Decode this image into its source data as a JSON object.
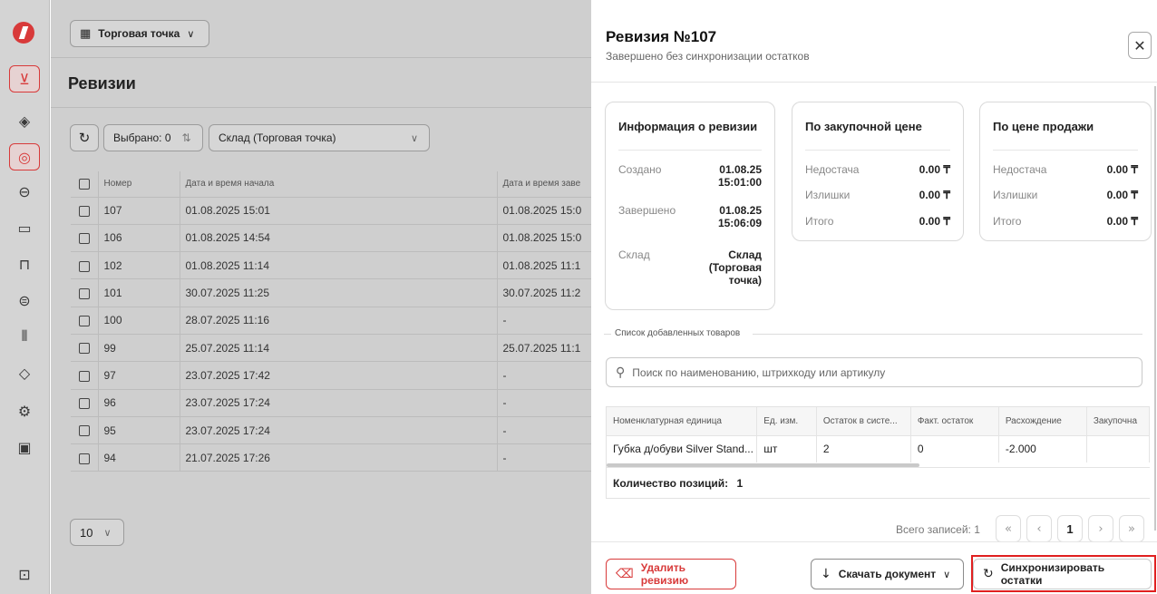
{
  "sidebar": {
    "icons": [
      "logo-icon",
      "cart-icon",
      "box-icon",
      "stack-icon",
      "bag-icon",
      "wallet-icon",
      "receipt-icon",
      "users-icon",
      "books-icon",
      "layers-icon",
      "settings-icon",
      "chart-icon",
      "exit-icon"
    ],
    "active": [
      "cart-icon",
      "stack-icon"
    ]
  },
  "header": {
    "store_button": "Торговая точка"
  },
  "page": {
    "title": "Ревизии",
    "selected_label": "Выбрано: 0",
    "warehouse_select": "Склад (Торговая точка)",
    "page_size": "10"
  },
  "revisions_table": {
    "columns": [
      "Номер",
      "Дата и время начала",
      "Дата и время заве"
    ],
    "rows": [
      {
        "number": "107",
        "start": "01.08.2025 15:01",
        "end": "01.08.2025 15:0"
      },
      {
        "number": "106",
        "start": "01.08.2025 14:54",
        "end": "01.08.2025 15:0"
      },
      {
        "number": "102",
        "start": "01.08.2025 11:14",
        "end": "01.08.2025 11:1"
      },
      {
        "number": "101",
        "start": "30.07.2025 11:25",
        "end": "30.07.2025 11:2"
      },
      {
        "number": "100",
        "start": "28.07.2025 11:16",
        "end": "-"
      },
      {
        "number": "99",
        "start": "25.07.2025 11:14",
        "end": "25.07.2025 11:1"
      },
      {
        "number": "97",
        "start": "23.07.2025 17:42",
        "end": "-"
      },
      {
        "number": "96",
        "start": "23.07.2025 17:24",
        "end": "-"
      },
      {
        "number": "95",
        "start": "23.07.2025 17:24",
        "end": "-"
      },
      {
        "number": "94",
        "start": "21.07.2025 17:26",
        "end": "-"
      }
    ]
  },
  "drawer": {
    "title": "Ревизия №107",
    "subtitle": "Завершено без синхронизации остатков",
    "info_card": {
      "title": "Информация о ревизии",
      "created_label": "Создано",
      "created_date": "01.08.25",
      "created_time": "15:01:00",
      "finished_label": "Завершено",
      "finished_date": "01.08.25",
      "finished_time": "15:06:09",
      "warehouse_label": "Склад",
      "warehouse_line1": "Склад",
      "warehouse_line2": "(Торговая",
      "warehouse_line3": "точка)"
    },
    "purchase_card": {
      "title": "По закупочной цене",
      "shortage_label": "Недостача",
      "shortage": "0.00 ₸",
      "surplus_label": "Излишки",
      "surplus": "0.00 ₸",
      "total_label": "Итого",
      "total": "0.00 ₸"
    },
    "sale_card": {
      "title": "По цене продажи",
      "shortage_label": "Недостача",
      "shortage": "0.00 ₸",
      "surplus_label": "Излишки",
      "surplus": "0.00 ₸",
      "total_label": "Итого",
      "total": "0.00 ₸"
    },
    "items_section_label": "Список добавленных товаров",
    "search_placeholder": "Поиск по наименованию, штрихкоду или артикулу",
    "items_table": {
      "columns": [
        "Номенклатурная единица",
        "Ед. изм.",
        "Остаток в систе...",
        "Факт. остаток",
        "Расхождение",
        "Закупочна"
      ],
      "rows": [
        {
          "name": "Губка д/обуви Silver Stand...",
          "unit": "шт",
          "system": "2",
          "actual": "0",
          "diff": "-2.000",
          "purchase": ""
        }
      ],
      "count_label": "Количество позиций:",
      "count": "1"
    },
    "pagination": {
      "total_label": "Всего записей: 1",
      "current_page": "1"
    },
    "buttons": {
      "delete": "Удалить ревизию",
      "download": "Скачать документ",
      "sync": "Синхронизировать остатки"
    }
  },
  "colors": {
    "accent": "#d83a3a",
    "highlight": "#e02020",
    "overlay": "#cfcfcf"
  }
}
